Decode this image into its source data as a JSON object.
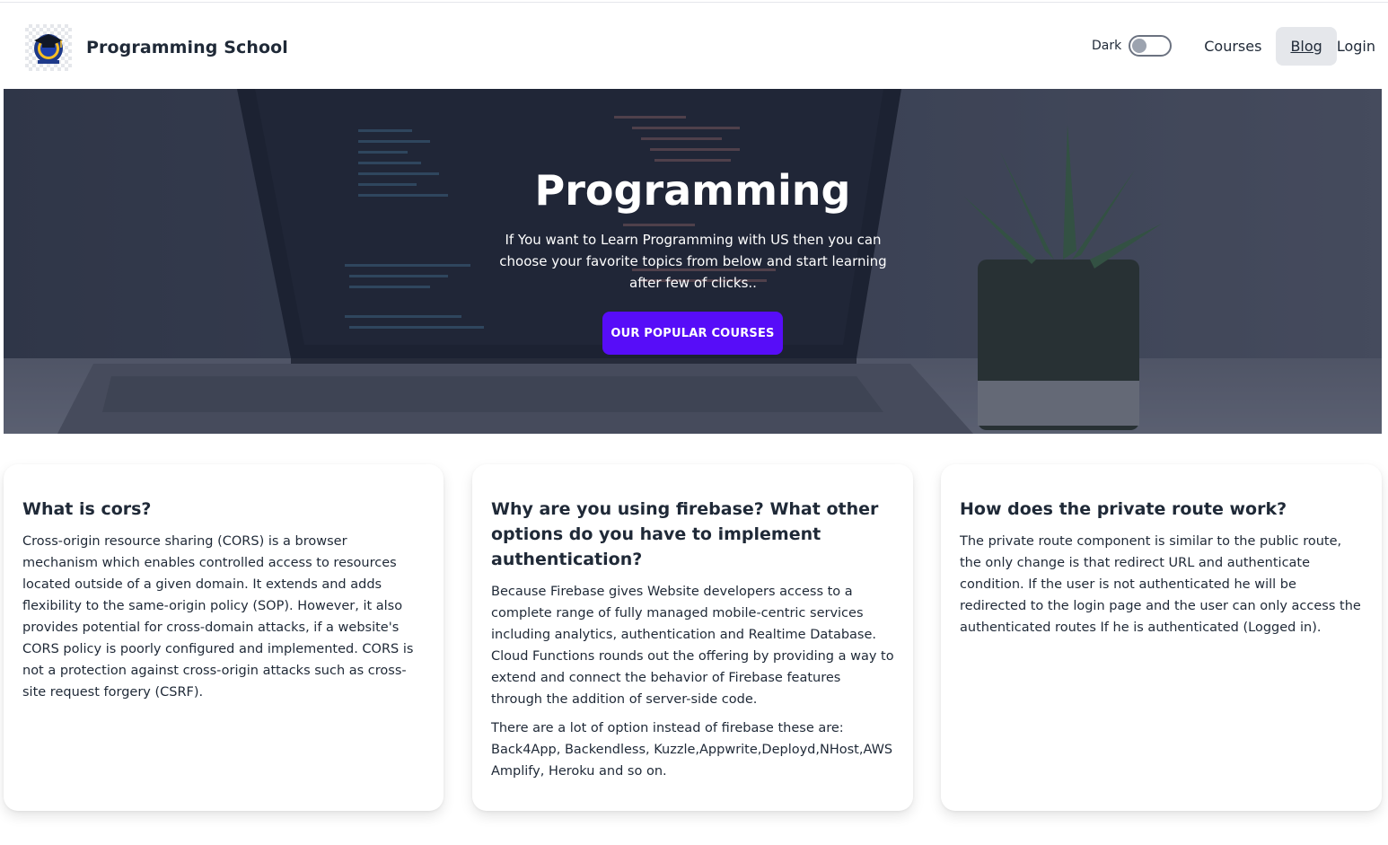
{
  "brand": {
    "name": "Programming School",
    "logo_icon": "graduation-cap-logo-icon"
  },
  "nav": {
    "dark_label": "Dark",
    "dark_mode_on": false,
    "courses": "Courses",
    "blog": "Blog",
    "login": "Login"
  },
  "hero": {
    "title": "Programming",
    "text": "If You want to Learn Programming with US then you can choose your favorite topics from below and start learning after few of clicks..",
    "button": "Our Popular Courses"
  },
  "cards": [
    {
      "title": "What is cors?",
      "paragraphs": [
        "Cross-origin resource sharing (CORS) is a browser mechanism which enables controlled access to resources located outside of a given domain. It extends and adds flexibility to the same-origin policy (SOP). However, it also provides potential for cross-domain attacks, if a website's CORS policy is poorly configured and implemented. CORS is not a protection against cross-origin attacks such as cross-site request forgery (CSRF)."
      ]
    },
    {
      "title": "Why are you using firebase? What other options do you have to implement authentication?",
      "paragraphs": [
        "Because Firebase gives Website developers access to a complete range of fully managed mobile-centric services including analytics, authentication and Realtime Database. Cloud Functions rounds out the offering by providing a way to extend and connect the behavior of Firebase features through the addition of server-side code.",
        "There are a lot of option instead of firebase these are: Back4App, Backendless, Kuzzle,Appwrite,Deployd,NHost,AWS Amplify, Heroku and so on."
      ]
    },
    {
      "title": "How does the private route work?",
      "paragraphs": [
        "The private route component is similar to the public route, the only change is that redirect URL and authenticate condition. If the user is not authenticated he will be redirected to the login page and the user can only access the authenticated routes If he is authenticated (Logged in)."
      ]
    }
  ],
  "colors": {
    "primary_button": "#570df8",
    "active_nav_bg": "#e5e7eb"
  }
}
